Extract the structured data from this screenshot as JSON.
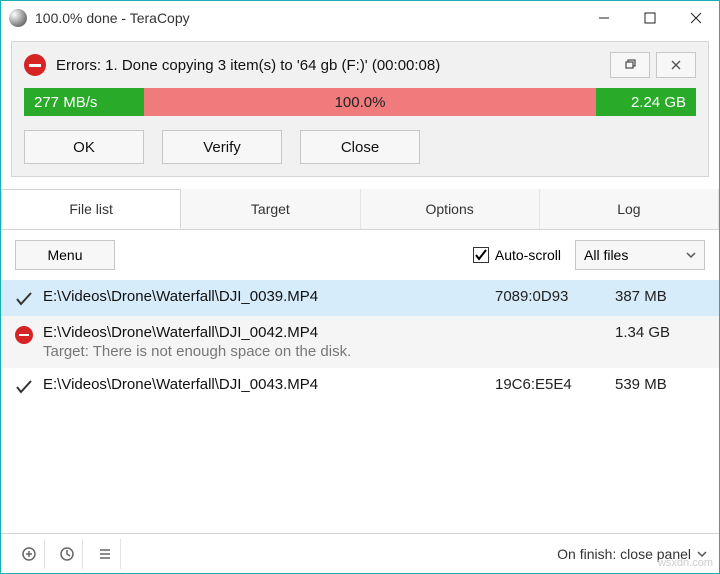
{
  "window": {
    "title": "100.0% done - TeraCopy"
  },
  "status": {
    "text": "Errors: 1. Done copying 3 item(s) to '64 gb (F:)' (00:00:08)",
    "speed": "277 MB/s",
    "percent": "100.0%",
    "total": "2.24 GB"
  },
  "actions": {
    "ok": "OK",
    "verify": "Verify",
    "close": "Close"
  },
  "tabs": {
    "file_list": "File list",
    "target": "Target",
    "options": "Options",
    "log": "Log"
  },
  "toolbar": {
    "menu": "Menu",
    "autoscroll": "Auto-scroll",
    "filter": "All files"
  },
  "files": [
    {
      "path": "E:\\Videos\\Drone\\Waterfall\\DJI_0039.MP4",
      "hash": "7089:0D93",
      "size": "387 MB",
      "status": "ok",
      "selected": true
    },
    {
      "path": "E:\\Videos\\Drone\\Waterfall\\DJI_0042.MP4",
      "hash": "",
      "size": "1.34 GB",
      "status": "error",
      "msg": "Target: There is not enough space on the disk."
    },
    {
      "path": "E:\\Videos\\Drone\\Waterfall\\DJI_0043.MP4",
      "hash": "19C6:E5E4",
      "size": "539 MB",
      "status": "ok"
    }
  ],
  "footer": {
    "on_finish": "On finish: close panel"
  },
  "watermark": "wsxdn.com"
}
